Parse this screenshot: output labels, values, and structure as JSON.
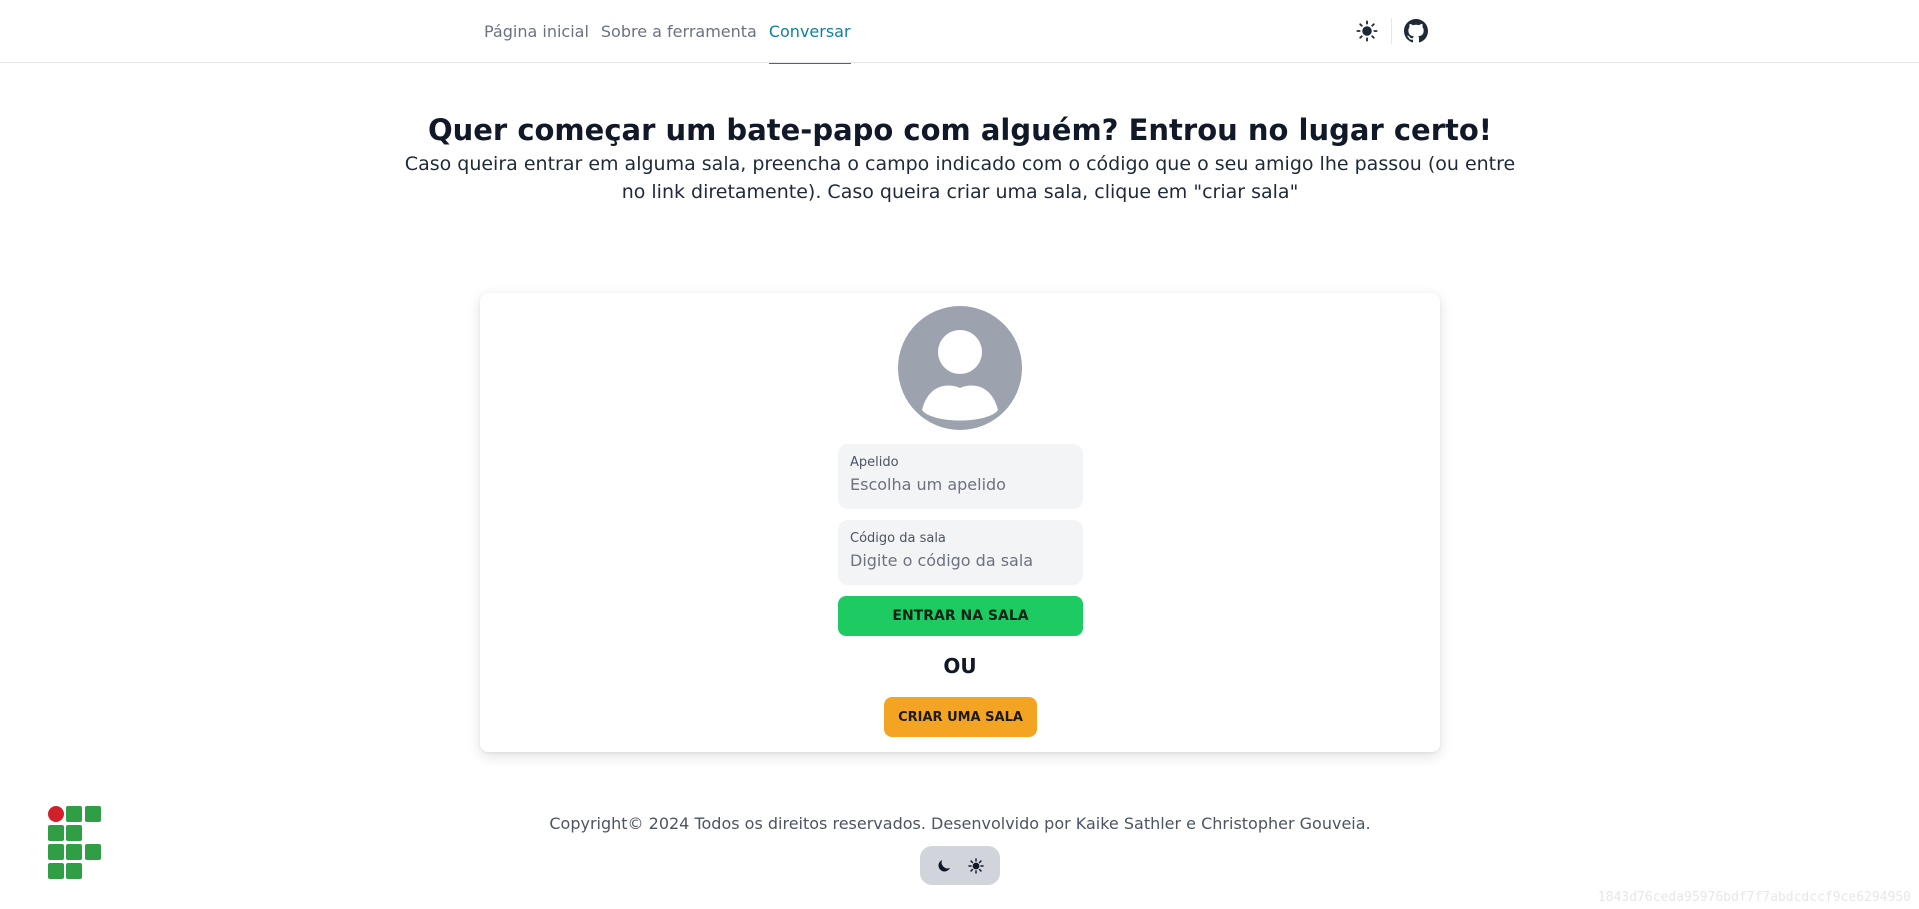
{
  "nav": {
    "items": [
      {
        "label": "Página inicial",
        "active": false
      },
      {
        "label": "Sobre a ferramenta",
        "active": false
      },
      {
        "label": "Conversar",
        "active": true
      }
    ],
    "active_color": "#0e7ea8"
  },
  "header_actions": {
    "theme_icon": "sun-icon",
    "repo_icon": "github-icon"
  },
  "hero": {
    "title": "Quer começar um bate-papo com alguém? Entrou no lugar certo!",
    "description": "Caso queira entrar em alguma sala, preencha o campo indicado com o código que o seu amigo lhe passou (ou entre no link diretamente). Caso queira criar uma sala, clique em \"criar sala\""
  },
  "form": {
    "avatar_icon": "user-avatar-icon",
    "nickname": {
      "label": "Apelido",
      "placeholder": "Escolha um apelido",
      "value": ""
    },
    "room_code": {
      "label": "Código da sala",
      "placeholder": "Digite o código da sala",
      "value": ""
    },
    "enter_button": "ENTRAR NA SALA",
    "or_text": "OU",
    "create_button": "CRIAR UMA SALA",
    "colors": {
      "enter": "#1ecb63",
      "create": "#f4a423",
      "avatar": "#9ca3af"
    }
  },
  "footer": {
    "copyright": "Copyright© 2024 Todos os direitos reservados. Desenvolvido por Kaike Sathler e Christopher Gouveia.",
    "logo_icon": "institution-logo",
    "theme_toggle": {
      "dark_icon": "moon-icon",
      "light_icon": "gear-sun-icon"
    },
    "hash": "1843d76ceda95976bdf7f7abdcdccf9ce6294950"
  }
}
